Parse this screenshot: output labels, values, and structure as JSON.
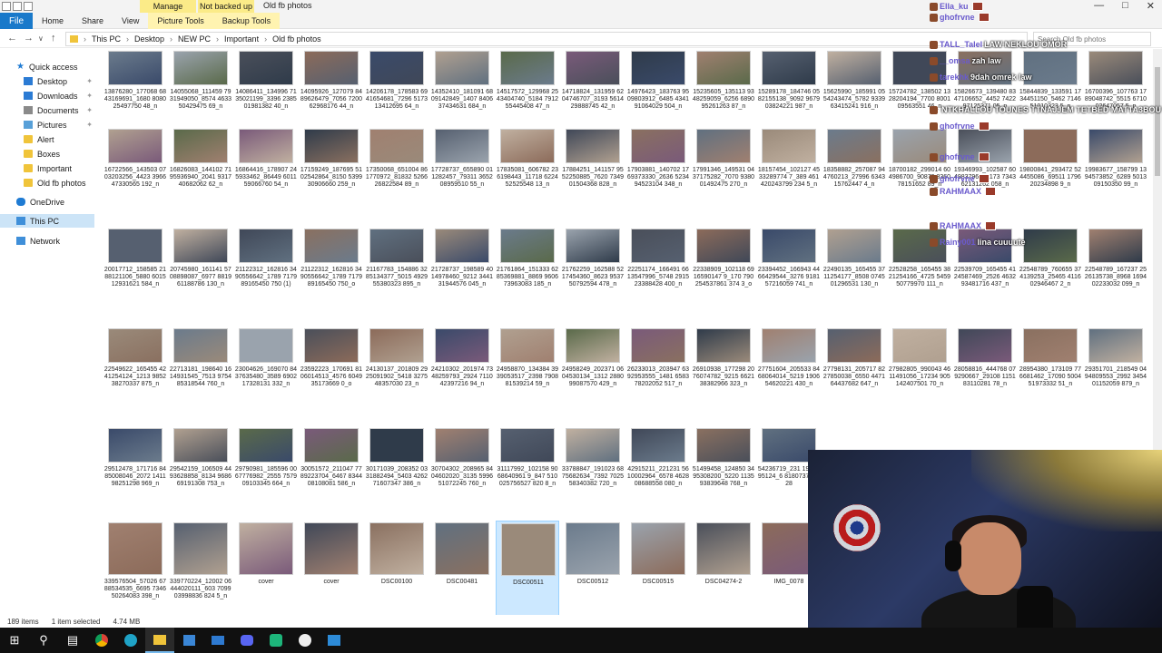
{
  "ribbon": {
    "file_tab": "File",
    "tabs": [
      "Home",
      "Share",
      "View"
    ],
    "ctx_tab_1": "Picture Tools",
    "ctx_tab_2": "Backup Tools",
    "ctx_head_1": "Manage",
    "ctx_head_2": "Not backed up",
    "window_title": "Old fb photos"
  },
  "address": {
    "crumbs": [
      "This PC",
      "Desktop",
      "NEW PC",
      "Important",
      "Old fb photos"
    ],
    "search_placeholder": "Search Old fb photos"
  },
  "nav": {
    "quick_access": "Quick access",
    "items": [
      "Desktop",
      "Downloads",
      "Documents",
      "Pictures",
      "Alert",
      "Boxes",
      "Important",
      "Old fb photos"
    ],
    "onedrive": "OneDrive",
    "this_pc": "This PC",
    "network": "Network"
  },
  "files": [
    [
      "13876280_177068 6843169691_1680 808025497750 48_n",
      "14055068_111459 7931949050_8574 463350429475 69_n",
      "14086411_134996 7135021199_3396 238501981382 40_n",
      "14095926_127079 8489626479_7056 720062968176 44_n",
      "14206178_178583 6941654681_7296 517313412695 64_n",
      "14352410_181091 6809142849_1407 840637434631 684_n",
      "14517572_129968 2543404740_5184 791255445408 47_n",
      "14718824_131959 6204746707_3193 561429888745 42_n",
      "14976423_183763 9509803912_6485 434191064029 504_n",
      "15235605_135113 9348259059_6256 689095261263 87_n",
      "15289178_184746 0582155138_9092 967903824221 987_n",
      "15625990_185991 0554243474_5782 933963415241 916_n",
      "15724782_138502 1328204194_7700 800109563551 46_n",
      "15826673_139480 8347106652_4452 742297125371 05_n",
      "15844839_133591 1734451150_5462 714651010323 5_n",
      "16700396_107763 1789048742_5515 671002647057 5_n"
    ],
    [
      "16722566_143503 0703203256_4423 396647330565 192_n",
      "16826083_144102 7195936940_2041 931740682062 62_n",
      "16864416_178907 245933462_86449 601159066760 54_n",
      "17159249_187695 5102542864_8150 539930906660 259_n",
      "17350068_651004 861770972_81832 526626822584 89_n",
      "17728737_655890 011282457_79311 365208959510 55_n",
      "17835081_606782 236198443_11718 622452525548 13_n",
      "17884251_141157 9552250885_7620 734901504368 828_n",
      "17903881_140702 1769373330_2636 523494523104 348_n",
      "17991346_149531 0437175282_7070 938001492475 270_n",
      "18157454_102127 4533289774 7_389 461420243799 234 5_n",
      "18358882_257087 944760213_27996 634315762447 4_n",
      "18700182_299014 604986700_90879 836078151652 89_n",
      "19346993_102587 6049837960_5173 734362131262 058_n",
      "19800841_293472 524455086_69511 179620234898 9_n",
      "19983677_158799 1394573852_6289 501309150350 99_n"
    ],
    [
      "20017712_158585 2188121106_5880 601512931621 584_n",
      "20745980_161141 5708898087_6977 881961188786 130_n",
      "21122312_162816 3490556642_1789 717989165450 750 (1)",
      "21122312_162816 3490556642_1789 717989165450 750_o",
      "21167783_154886 3285134377_5015 492955380323 895_n",
      "21728737_198589 4014978460_9212 344131944576 045_n",
      "21761864_151333 6285369881_8869 960673963083 185_n",
      "21762259_162588 5217454360_8623 953750792594 478_n",
      "22251174_166491 6613547996_5748 291523388428 400_n",
      "22338909_102118 6916590147 9_170 790254537861 374 3_o",
      "23394452_166943 4466429544_3276 918157216059 741_n",
      "22490135_165455 3711254177_8508 074501296531 130_n",
      "22528258_165455 3821254166_4725 545950779970 111_n",
      "22539709_165455 4124587469_2526 463293481716 437_n",
      "22548789_760655 374139253_25465 411602946467 2_n",
      "22548789_167237 2526135738_8968 169402233032 099_n"
    ],
    [
      "22549622_165455 4241254124_1213 985238270337 875_n",
      "22713181_198640 1614931545_7513 975485318544 760_n",
      "23004626_169070 8437635480_3589 690217328131 332_n",
      "23592223_170691 8106014513_4576 604935173669 0_o",
      "24130137_201809 2925091902_5418 327548357030 23_n",
      "24210302_201974 7348259793_2924 711042397216 94_n",
      "24958870_134384 3939053517_2398 790881539214 59_n",
      "24958249_202371 0604530134_1312 288099087570 429_n",
      "26233013_203947 6392953555_1481 658378202052 517_n",
      "26910938_177298 2076074782_9215 662138382966 323_n",
      "27751604_205533 8468064014_5219 190654620221 430_n",
      "27798131_205717 8227850038_6550 447164437682 647_n",
      "27982805_990043 4611491056_17234 905142407501 70_n",
      "28058816_444768 079290667_29108 115183110281 78_n",
      "28954380_173109 776681462_17090 500451973332 51_n",
      "29351701_218549 0494809553_2992 345401152059 879_n"
    ],
    [
      "29512478_171716 8485008046_2072 141198251298 969_n",
      "29542159_106509 4493628858_8134 968669191308 753_n",
      "29790981_185596 0067776982_2555 757909103345 664_n",
      "30051572_211047 7789223704_6467 834408108081 586_n",
      "30171039_208352 0331882494_5403 426271607347 386_n",
      "30704302_208965 8404602020_3135 599651072245 760_n",
      "31117992_102158 9068640961 9_847 510025756527 820 8_n",
      "33788847_191023 6875682634_7392 702558340382 720_n",
      "42915211_221231 5610002964_6578 462808688558 080_n",
      "51499458_124850 3495308200_5220 113593839648 768_n",
      "54236719_231 1935295124_6 818073737428",
      "",
      "",
      "",
      "",
      ""
    ],
    [
      "339576504_57026 6788534535_6695 734650264083 398_n",
      "339770224_12002 06444020111_603 709903998836 824 5_n",
      "cover",
      "cover",
      "DSC00100",
      "DSC00481",
      "DSC00511",
      "DSC00512",
      "DSC00515",
      "DSC04274-2",
      "IMG_0078"
    ]
  ],
  "status": {
    "count": "189 items",
    "selection": "1 item selected",
    "size": "4.74 MB"
  },
  "chat": [
    {
      "user": "Ella_ku",
      "msg": ""
    },
    {
      "user": "ghofrvne",
      "msg": ""
    },
    {
      "user": "TALL_Talel",
      "msg": "LAW NEKLOU OMOR"
    },
    {
      "user": "__omsa",
      "msg": "zah law"
    },
    {
      "user": "tarekhk",
      "msg": "9dah omrek law"
    },
    {
      "user": "",
      "msg": "NTKHALLOU TOUNES TTNAJJEM TETBED MATTA3BOU"
    },
    {
      "user": "ghofrvne",
      "msg": ""
    },
    {
      "user": "ghofrvne",
      "msg": ""
    },
    {
      "user": "ghofrvne",
      "msg": ""
    },
    {
      "user": "RAHMAAX",
      "msg": ""
    },
    {
      "user": "RAHMAAX",
      "msg": ""
    },
    {
      "user": "Rainy001",
      "msg": "lina cuuuute"
    }
  ]
}
